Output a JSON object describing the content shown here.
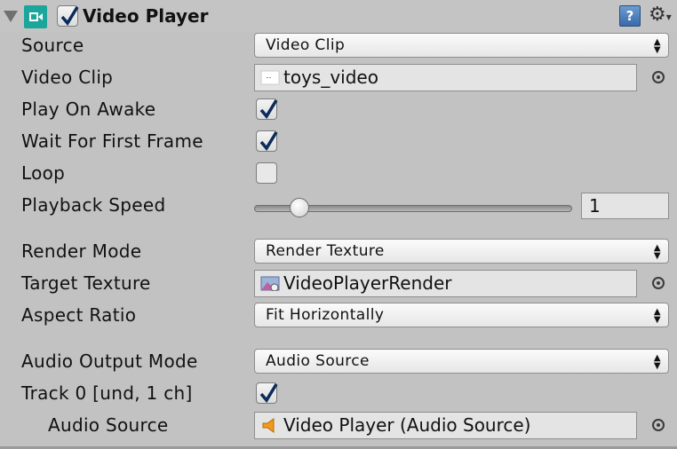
{
  "component": {
    "title": "Video Player",
    "enabled": true,
    "icon": "video-player-icon",
    "help_icon": "help-book-icon",
    "settings_icon": "gear-icon",
    "help_glyph": "?"
  },
  "fields": {
    "source": {
      "label": "Source",
      "value": "Video Clip"
    },
    "video_clip": {
      "label": "Video Clip",
      "value": "toys_video",
      "icon": "video-clip-icon"
    },
    "play_on_awake": {
      "label": "Play On Awake",
      "checked": true
    },
    "wait_first_frame": {
      "label": "Wait For First Frame",
      "checked": true
    },
    "loop": {
      "label": "Loop",
      "checked": false
    },
    "playback_speed": {
      "label": "Playback Speed",
      "value": "1",
      "slider_fraction": 0.12
    },
    "render_mode": {
      "label": "Render Mode",
      "value": "Render Texture"
    },
    "target_texture": {
      "label": "Target Texture",
      "value": "VideoPlayerRender",
      "icon": "render-texture-icon"
    },
    "aspect_ratio": {
      "label": "Aspect Ratio",
      "value": "Fit Horizontally"
    },
    "audio_output_mode": {
      "label": "Audio Output Mode",
      "value": "Audio Source"
    },
    "track_0": {
      "label": "Track 0 [und, 1 ch]",
      "checked": true
    },
    "audio_source": {
      "label": "Audio Source",
      "value": "Video Player (Audio Source)",
      "icon": "audio-source-icon"
    }
  },
  "colors": {
    "panel_bg": "#c2c2c2",
    "component_icon": "#1aa69a",
    "audio_icon": "#f29a1e"
  }
}
